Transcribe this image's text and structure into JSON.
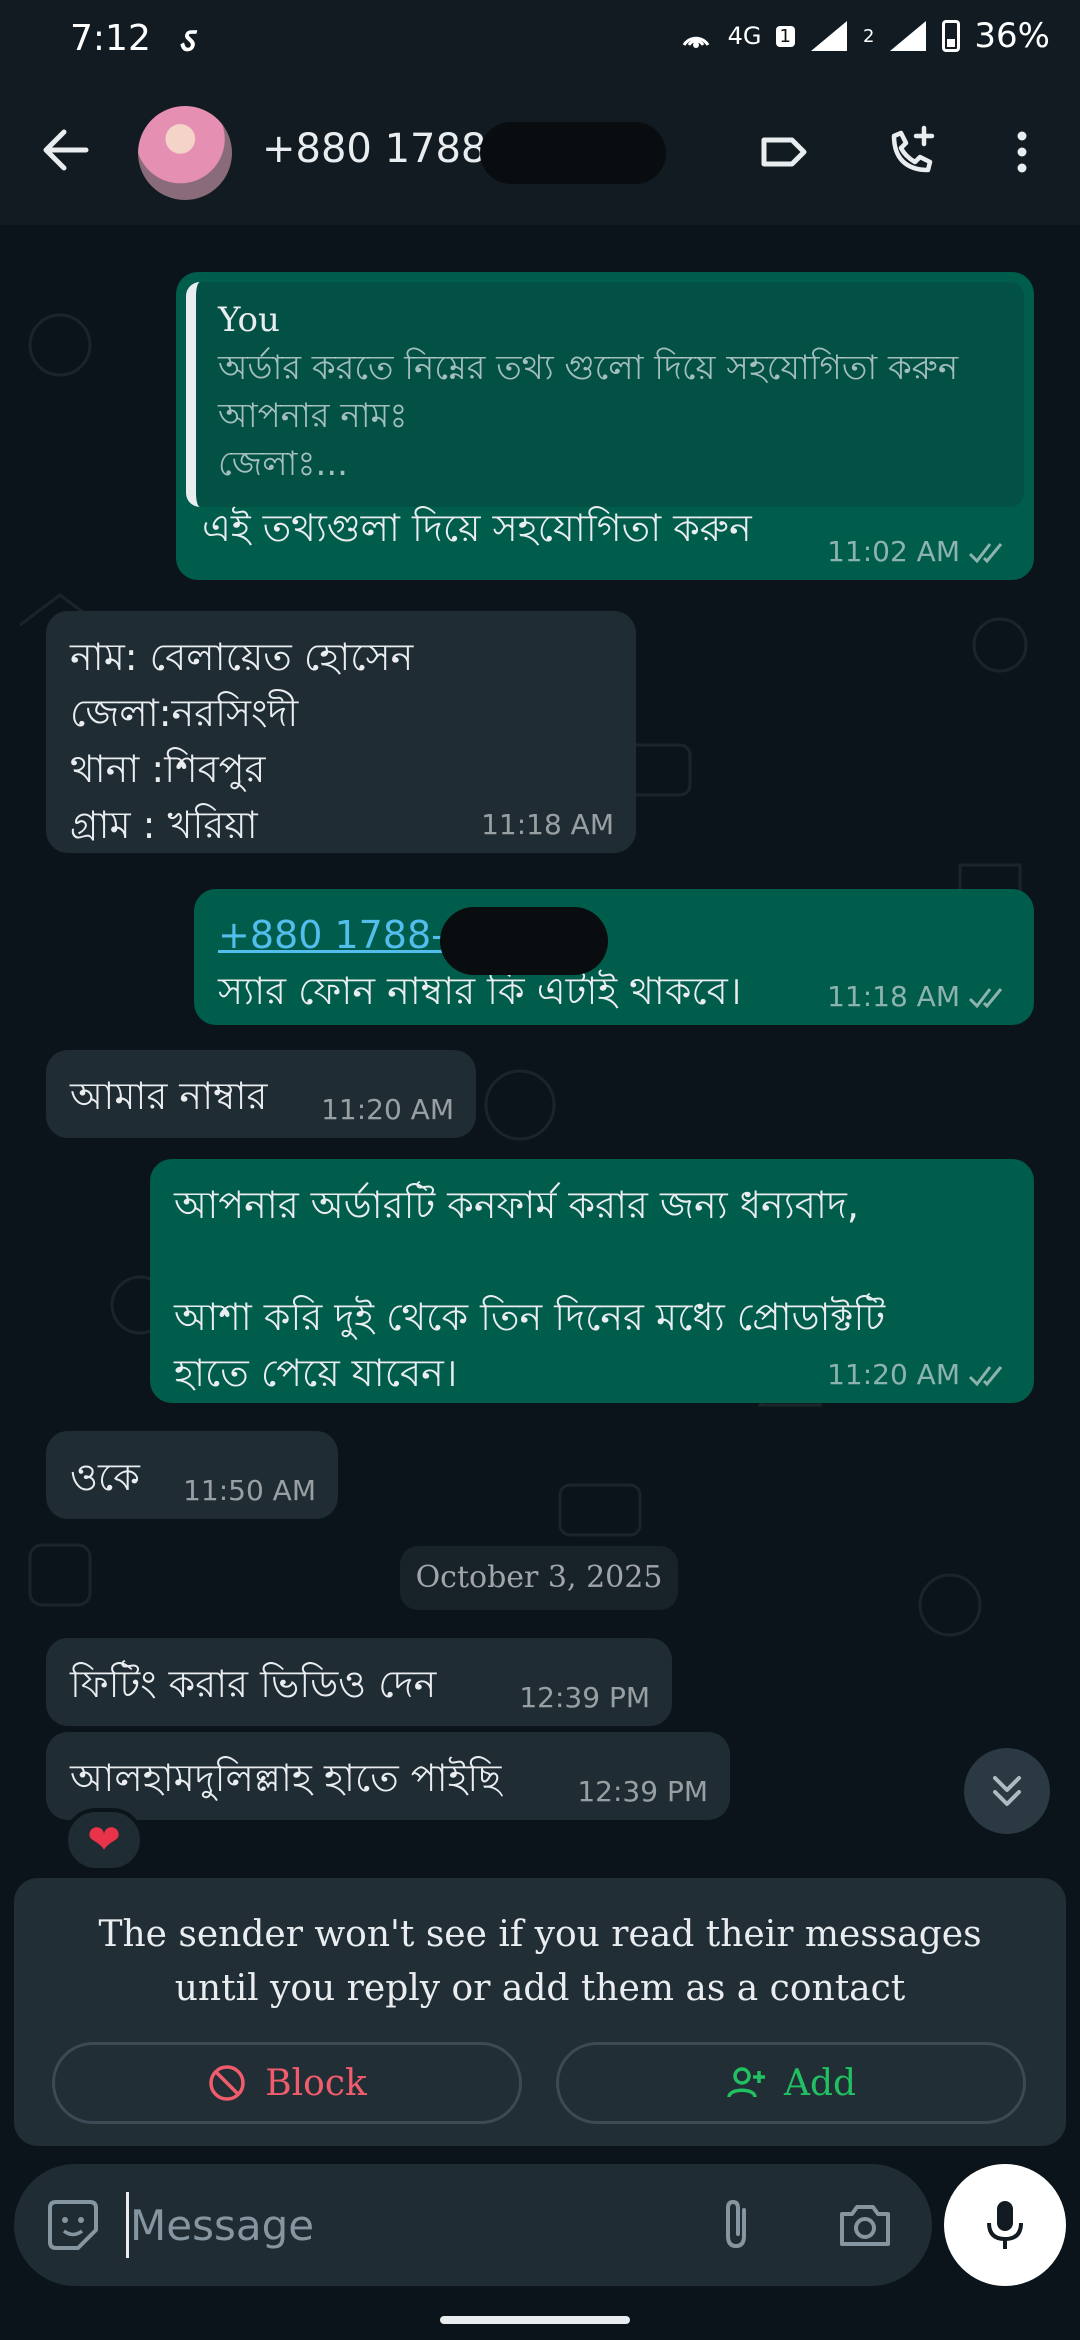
{
  "status_bar": {
    "time": "7:12",
    "network": "4G",
    "sim1_badge": "1",
    "sim2_badge": "2",
    "battery": "36%"
  },
  "header": {
    "contact": "+880 1788-",
    "icons": [
      "back-arrow-icon",
      "label-icon",
      "add-call-icon",
      "more-vert-icon"
    ]
  },
  "messages": [
    {
      "direction": "out",
      "quote": {
        "sender": "You",
        "lines": [
          "অর্ডার করতে নিম্নের তথ্য গুলো দিয়ে সহযোগিতা করুন",
          "আপনার নামঃ",
          "জেলাঃ..."
        ]
      },
      "text": "এই তথ্যগুলা দিয়ে সহযোগিতা করুন",
      "time": "11:02 AM"
    },
    {
      "direction": "in",
      "lines": [
        "নাম: বেলায়েত হোসেন",
        "জেলা:নরসিংদী",
        "থানা :শিবপুর",
        "গ্রাম : খরিয়া"
      ],
      "time": "11:18 AM"
    },
    {
      "direction": "out",
      "link": "+880 1788-",
      "text": " স্যার ফোন নাম্বার কি এটাই থাকবে।",
      "time": "11:18 AM"
    },
    {
      "direction": "in",
      "text": "আমার নাম্বার",
      "time": "11:20 AM"
    },
    {
      "direction": "out",
      "lines": [
        "আপনার অর্ডারটি কনফার্ম করার জন্য ধন্যবাদ,",
        "",
        "আশা করি দুই থেকে তিন দিনের মধ্যে প্রোডাক্টটি",
        "হাতে পেয়ে যাবেন।"
      ],
      "time": "11:20 AM"
    },
    {
      "direction": "in",
      "text": "ওকে",
      "time": "11:50 AM"
    },
    {
      "direction": "in",
      "text": "ফিটিং করার  ভিডিও দেন",
      "time": "12:39 PM"
    },
    {
      "direction": "in",
      "text": "আলহামদুলিল্লাহ হাতে পাইছি",
      "time": "12:39 PM",
      "reaction": "❤"
    }
  ],
  "date_divider": "October 3, 2025",
  "notice": {
    "text": "The sender won't see if you read their messages until you reply or add them as a contact",
    "block_label": "Block",
    "add_label": "Add"
  },
  "composer": {
    "placeholder": "Message"
  },
  "colors": {
    "background": "#0b141a",
    "incoming_bubble": "#202c33",
    "outgoing_bubble": "#005c4b",
    "link": "#53bdeb",
    "block_red": "#f15c6d",
    "add_green": "#21c063"
  }
}
